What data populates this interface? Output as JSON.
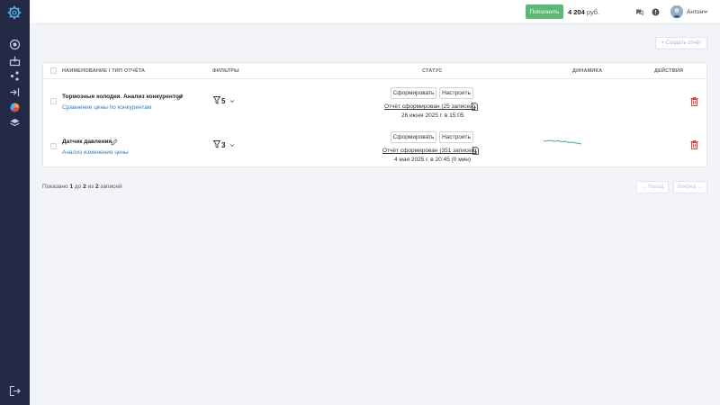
{
  "colors": {
    "sidebar": "#222a45",
    "accent_green": "#5cb875",
    "link_blue": "#2f80c9",
    "danger": "#e0424f"
  },
  "header": {
    "topup_label": "Пополнить",
    "balance_amount": "4 204",
    "balance_currency": "руб.",
    "username": "Антон",
    "icons": [
      "chat-icon",
      "info-icon",
      "avatar",
      "chevron-down-icon"
    ]
  },
  "sidebar": {
    "icons": [
      "settings-logo-icon",
      "dashboard-icon",
      "inbox-icon",
      "nodes-icon",
      "login-icon",
      "pie-chart-icon",
      "layers-icon",
      "logout-icon"
    ]
  },
  "toolbar": {
    "create_label": "Создать отчёт"
  },
  "table": {
    "columns": {
      "name": "Наименование / тип отчёта",
      "filters": "Фильтры",
      "status": "Статус",
      "dynamics": "Динамика",
      "actions": "Действия"
    },
    "rows": [
      {
        "title": "Тормозные колодки. Анализ конкурентов",
        "subtitle": "Сравнение цены по конкурентам",
        "filters_count": "5",
        "btn_generate": "Сформировать",
        "btn_configure": "Настроить",
        "report_link": "Отчёт сформирован (25 записей)",
        "report_date": "26 июня 2025 г. в 15:05",
        "has_sparkline": false
      },
      {
        "title": "Датчик давления",
        "subtitle": "Анализ изменения цены",
        "filters_count": "3",
        "btn_generate": "Сформировать",
        "btn_configure": "Настроить",
        "report_link": "Отчёт сформирован (351 записей)",
        "report_date": "4 мая 2025 г. в 20:45 (0 мин)",
        "has_sparkline": true
      }
    ]
  },
  "pagination": {
    "shown_prefix": "Показано",
    "from": "1",
    "to_word": "до",
    "to": "2",
    "of_word": "из",
    "total": "2",
    "suffix": "записей",
    "prev_label": "Назад",
    "next_label": "Вперед"
  }
}
